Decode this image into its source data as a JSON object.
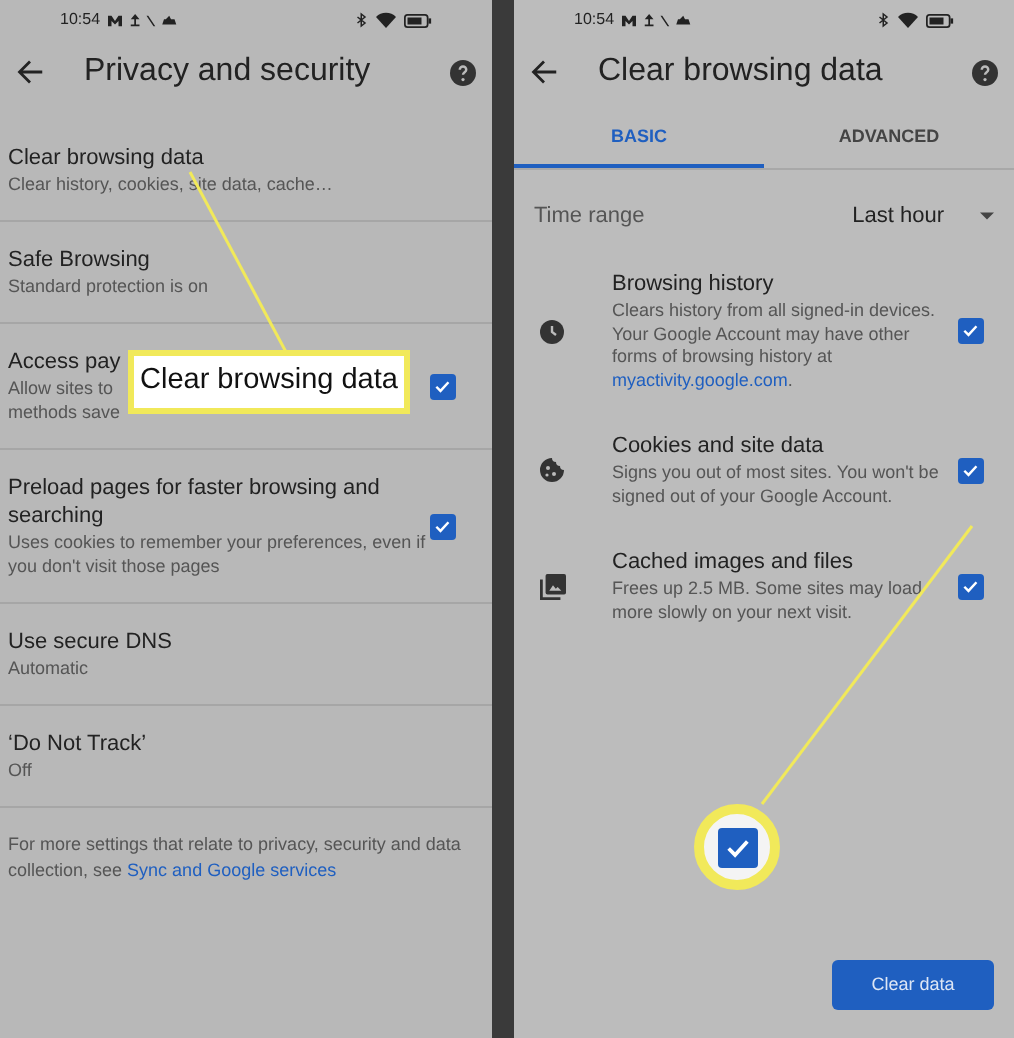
{
  "left": {
    "status_time": "10:54",
    "title": "Privacy and security",
    "items": [
      {
        "kind": "plain",
        "title": "Clear browsing data",
        "description_lines": [
          "Clear history, cookies, site data, cache…"
        ]
      },
      {
        "kind": "plain",
        "title": "Safe Browsing",
        "description_lines": [
          "Standard protection is on"
        ]
      },
      {
        "kind": "checkbox",
        "checked": true,
        "title": "Access pay",
        "description_lines": [
          "Allow sites to",
          "methods save"
        ]
      },
      {
        "kind": "checkbox",
        "checked": true,
        "title": "Preload pages for faster browsing and searching",
        "description_lines": [
          "Uses cookies to remember your preferences, even if you don't visit those pages"
        ]
      },
      {
        "kind": "plain",
        "title": "Use secure DNS",
        "description_lines": [
          "Automatic"
        ]
      },
      {
        "kind": "plain",
        "title": "‘Do Not Track’",
        "description_lines": [
          "Off"
        ]
      }
    ],
    "footer": {
      "text": "For more settings that relate to privacy, security and data collection, see ",
      "link": "Sync and Google services"
    },
    "callout": {
      "text": "Clear browsing data"
    }
  },
  "right": {
    "status_time": "10:54",
    "title": "Clear browsing data",
    "tabs": [
      {
        "label": "BASIC",
        "selected": true
      },
      {
        "label": "ADVANCED",
        "selected": false
      }
    ],
    "time_range": {
      "label": "Time range",
      "value": "Last hour"
    },
    "items": [
      {
        "title": "Browsing history",
        "description": "Clears history from all signed-in devices. Your Google Account may have other forms of browsing history at ",
        "link": "myactivity.google.com",
        "after": ".",
        "checked": true
      },
      {
        "title": "Cookies and site data",
        "description": "Signs you out of most sites. You won't be signed out of your Google Account.",
        "checked": true
      },
      {
        "title": "Cached images and files",
        "description": "Frees up 2.5 MB. Some sites may load more slowly on your next visit.",
        "checked": true
      }
    ],
    "zoom_callout": {
      "checked": true
    },
    "button": "Clear data"
  }
}
